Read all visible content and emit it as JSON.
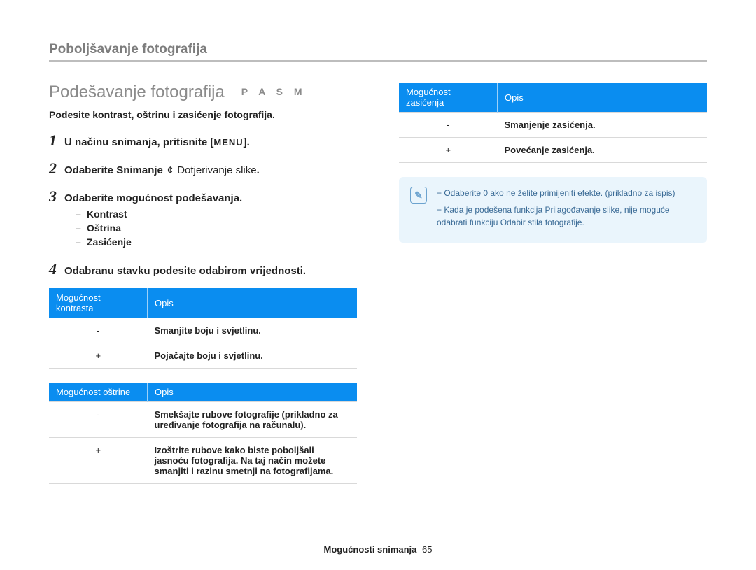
{
  "header": "Poboljšavanje fotografija",
  "section_title": "Podešavanje fotografija",
  "modes": "P A S M",
  "subtitle": "Podesite kontrast, oštrinu i zasićenje fotografija.",
  "steps": {
    "s1_pre": "U načinu snimanja, pritisnite [",
    "s1_menu": "MENU",
    "s1_post": "].",
    "s2_pre": "Odaberite ",
    "s2_cat": "Snimanje",
    "s2_arrow": "¢",
    "s2_item": "Dotjerivanje slike",
    "s2_post": ".",
    "s3": "Odaberite mogućnost podešavanja.",
    "s3_items": [
      "Kontrast",
      "Oštrina",
      "Zasićenje"
    ],
    "s4": "Odabranu stavku podesite odabirom vrijednosti."
  },
  "tables": {
    "contrast": {
      "head": [
        "Mogućnost kontrasta",
        "Opis"
      ],
      "rows": [
        [
          "-",
          "Smanjite boju i svjetlinu."
        ],
        [
          "+",
          "Pojačajte boju i svjetlinu."
        ]
      ]
    },
    "sharpness": {
      "head": [
        "Mogućnost oštrine",
        "Opis"
      ],
      "rows": [
        [
          "-",
          "Smekšajte rubove fotografije (prikladno za uređivanje fotografija na računalu)."
        ],
        [
          "+",
          "Izoštrite rubove kako biste poboljšali jasnoću fotografija. Na taj način možete smanjiti i razinu smetnji na fotografijama."
        ]
      ]
    },
    "saturation": {
      "head": [
        "Mogućnost zasićenja",
        "Opis"
      ],
      "rows": [
        [
          "-",
          "Smanjenje zasićenja."
        ],
        [
          "+",
          "Povećanje zasićenja."
        ]
      ]
    }
  },
  "note_items": [
    "Odaberite 0 ako ne želite primijeniti efekte. (prikladno za ispis)",
    "Kada je podešena funkcija Prilagođavanje slike, nije moguće odabrati funkciju Odabir stila fotografije."
  ],
  "footer_label": "Mogućnosti snimanja",
  "footer_page": "65"
}
